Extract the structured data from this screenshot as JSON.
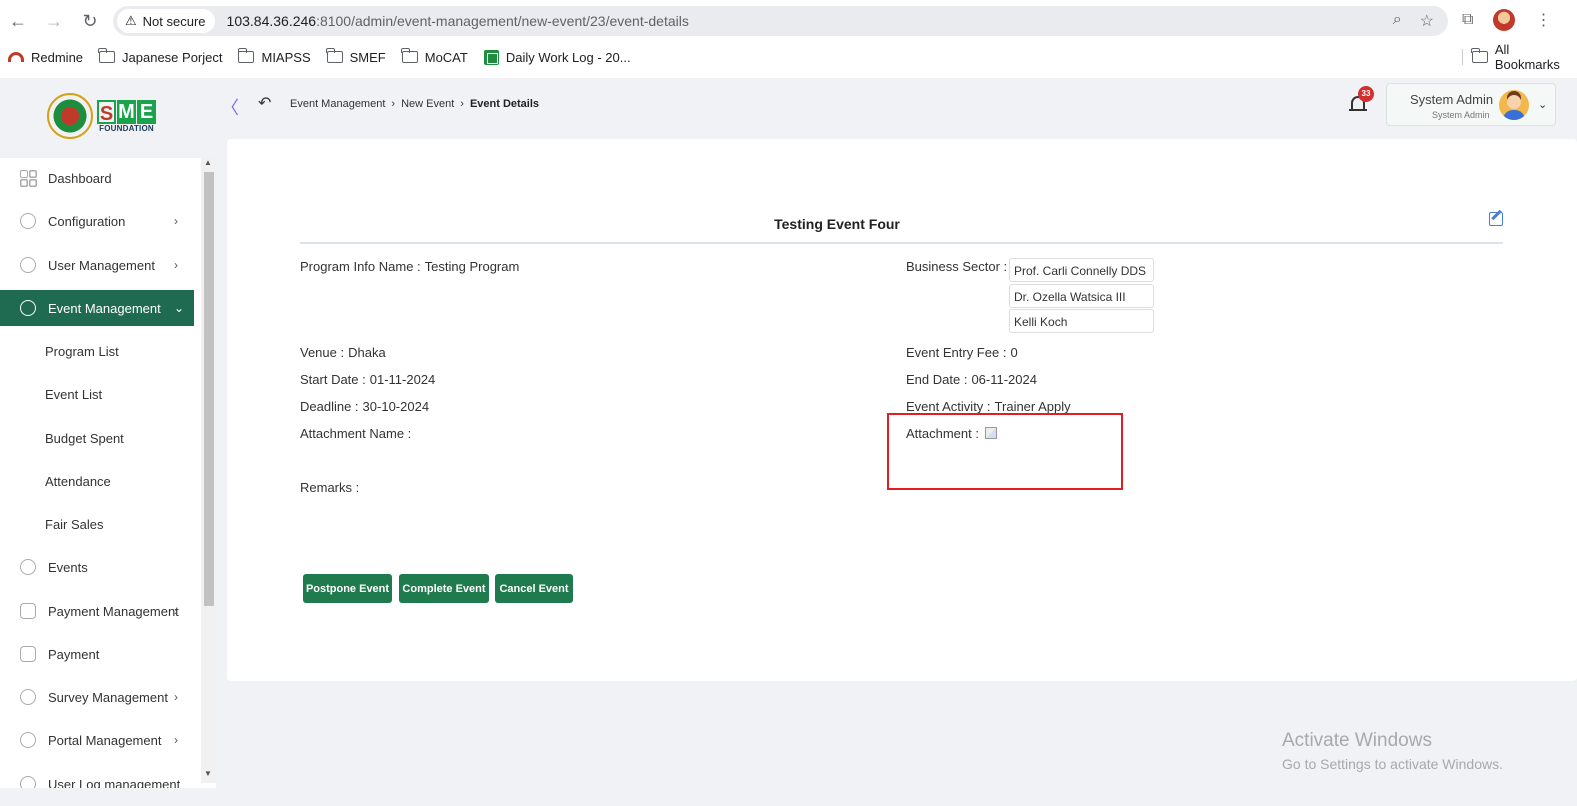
{
  "browser": {
    "security_label": "Not secure",
    "url_host": "103.84.36.246",
    "url_rest": ":8100/admin/event-management/new-event/23/event-details",
    "bookmarks": [
      "Redmine",
      "Japanese Porject",
      "MIAPSS",
      "SMEF",
      "MoCAT",
      "Daily Work Log - 20..."
    ],
    "all_bookmarks": "All Bookmarks"
  },
  "header": {
    "logo_text": "SME",
    "logo_sub": "FOUNDATION",
    "breadcrumb": [
      "Event Management",
      "New Event",
      "Event Details"
    ],
    "notification_count": "33",
    "user_name": "System Admin",
    "user_role": "System Admin"
  },
  "sidebar": {
    "items": [
      {
        "label": "Dashboard"
      },
      {
        "label": "Configuration"
      },
      {
        "label": "User Management"
      },
      {
        "label": "Event Management"
      },
      {
        "label": "Events"
      },
      {
        "label": "Payment Management"
      },
      {
        "label": "Payment"
      },
      {
        "label": "Survey Management"
      },
      {
        "label": "Portal Management"
      },
      {
        "label": "User Log management"
      }
    ],
    "sub_items": [
      "Program List",
      "Event List",
      "Budget Spent",
      "Attendance",
      "Fair Sales"
    ]
  },
  "event": {
    "title": "Testing Event Four",
    "program_label": "Program Info Name :",
    "program_value": "Testing Program",
    "sector_label": "Business Sector :",
    "sectors": [
      "Prof. Carli Connelly DDS",
      "Dr. Ozella Watsica III",
      "Kelli Koch"
    ],
    "venue_label": "Venue :",
    "venue_value": "Dhaka",
    "fee_label": "Event Entry Fee :",
    "fee_value": "0",
    "start_label": "Start Date :",
    "start_value": "01-11-2024",
    "end_label": "End Date :",
    "end_value": "06-11-2024",
    "deadline_label": "Deadline :",
    "deadline_value": "30-10-2024",
    "activity_label": "Event Activity :",
    "activity_value": "Trainer Apply",
    "attachment_name_label": "Attachment Name :",
    "attachment_label": "Attachment :",
    "remarks_label": "Remarks :"
  },
  "actions": {
    "postpone": "Postpone Event",
    "complete": "Complete Event",
    "cancel": "Cancel Event"
  },
  "watermark": {
    "line1": "Activate Windows",
    "line2": "Go to Settings to activate Windows."
  }
}
